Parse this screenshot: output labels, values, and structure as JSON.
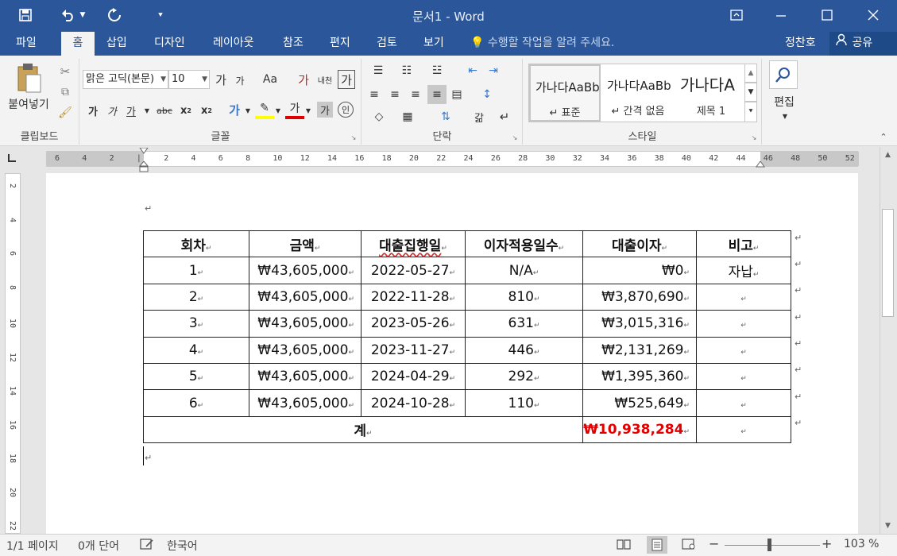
{
  "window": {
    "title": "문서1 - Word"
  },
  "ribbon_tabs": [
    "파일",
    "홈",
    "삽입",
    "디자인",
    "레이아웃",
    "참조",
    "편지",
    "검토",
    "보기"
  ],
  "active_tab": "홈",
  "tell_me": "수행할 작업을 알려 주세요.",
  "user": {
    "name": "정찬호",
    "share": "공유"
  },
  "ribbon": {
    "clipboard": {
      "paste": "붙여넣기",
      "label": "클립보드"
    },
    "font": {
      "name": "맑은 고딕(본문)",
      "size": "10",
      "label": "글꼴",
      "glyph_ga": "가",
      "grow": "가",
      "shrink": "가",
      "case": "Aa",
      "phonetic": "내천",
      "bold": "가",
      "italic": "가",
      "underline": "가",
      "strike": "abc",
      "sub": "x",
      "sup": "x"
    },
    "paragraph": {
      "label": "단락"
    },
    "styles": {
      "label": "스타일",
      "items": [
        {
          "sample": "가나다AaBb",
          "name": "표준"
        },
        {
          "sample": "가나다AaBb",
          "name": "간격 없음"
        },
        {
          "sample": "가나다A",
          "name": "제목 1"
        }
      ]
    },
    "editing": {
      "label": "편집"
    }
  },
  "ruler": {
    "h_ticks": [
      "6",
      "4",
      "2",
      "",
      "2",
      "4",
      "6",
      "8",
      "10",
      "12",
      "14",
      "16",
      "18",
      "20",
      "22",
      "24",
      "26",
      "28",
      "30",
      "32",
      "34",
      "36",
      "38",
      "40",
      "42",
      "44",
      "46",
      "48",
      "50",
      "52"
    ],
    "v_ticks": [
      "2",
      "4",
      "6",
      "8",
      "10",
      "12",
      "14",
      "16",
      "18",
      "20",
      "22"
    ]
  },
  "table": {
    "headers": [
      "회차",
      "금액",
      "대출집행일",
      "이자적용일수",
      "대출이자",
      "비고"
    ],
    "rows": [
      [
        "1",
        "₩43,605,000",
        "2022-05-27",
        "N/A",
        "₩0",
        "자납"
      ],
      [
        "2",
        "₩43,605,000",
        "2022-11-28",
        "810",
        "₩3,870,690",
        ""
      ],
      [
        "3",
        "₩43,605,000",
        "2023-05-26",
        "631",
        "₩3,015,316",
        ""
      ],
      [
        "4",
        "₩43,605,000",
        "2023-11-27",
        "446",
        "₩2,131,269",
        ""
      ],
      [
        "5",
        "₩43,605,000",
        "2024-04-29",
        "292",
        "₩1,395,360",
        ""
      ],
      [
        "6",
        "₩43,605,000",
        "2024-10-28",
        "110",
        "₩525,649",
        ""
      ]
    ],
    "total_label": "계",
    "total_value": "₩10,938,284",
    "total_note": ""
  },
  "status": {
    "page": "1/1 페이지",
    "words": "0개 단어",
    "language": "한국어",
    "zoom": "103 %",
    "zoom_level": 1.03
  },
  "colors": {
    "brand": "#2b579a",
    "total_red": "#e00000"
  }
}
